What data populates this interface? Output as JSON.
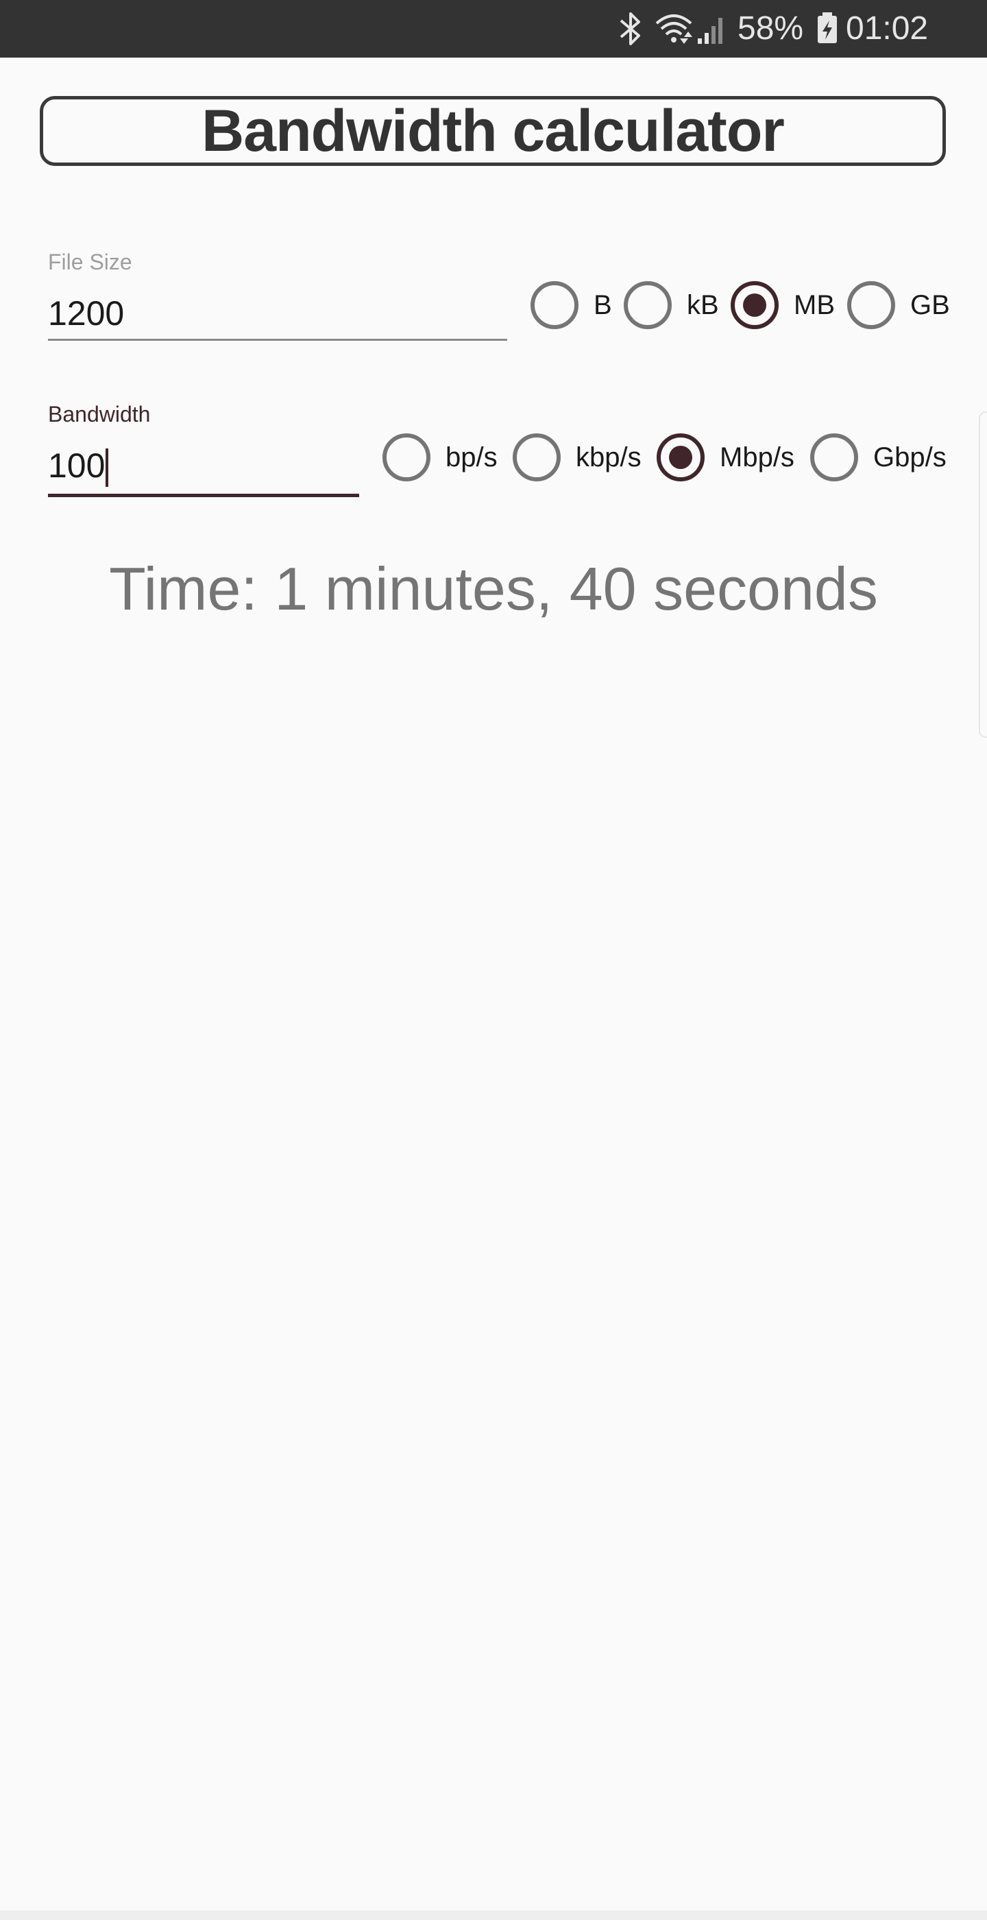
{
  "status_bar": {
    "battery": "58%",
    "time": "01:02",
    "icons": [
      "bluetooth-icon",
      "wifi-icon",
      "signal-icon",
      "battery-icon"
    ]
  },
  "title": "Bandwidth calculator",
  "file_size": {
    "label": "File Size",
    "value": "1200",
    "units": [
      {
        "label": "B",
        "checked": false
      },
      {
        "label": "kB",
        "checked": false
      },
      {
        "label": "MB",
        "checked": true
      },
      {
        "label": "GB",
        "checked": false
      }
    ]
  },
  "bandwidth": {
    "label": "Bandwidth",
    "value": "100",
    "units": [
      {
        "label": "bp/s",
        "checked": false
      },
      {
        "label": "kbp/s",
        "checked": false
      },
      {
        "label": "Mbp/s",
        "checked": true
      },
      {
        "label": "Gbp/s",
        "checked": false
      }
    ]
  },
  "result": "Time: 1 minutes, 40 seconds",
  "colors": {
    "accent": "#40252a",
    "status_bar": "#333333",
    "background": "#fafafa",
    "unchecked": "#757575"
  }
}
